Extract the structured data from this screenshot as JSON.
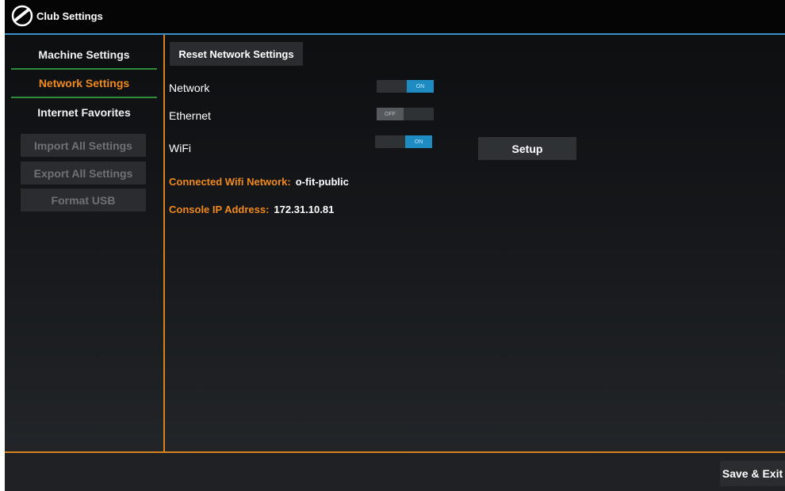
{
  "window": {
    "title": "Club Settings",
    "logo_icon": "brand-logo-icon"
  },
  "sidebar": {
    "items": [
      {
        "label": "Machine Settings"
      },
      {
        "label": "Network Settings",
        "active": true
      },
      {
        "label": "Internet Favorites"
      }
    ],
    "disabled_buttons": [
      {
        "label": "Import All Settings"
      },
      {
        "label": "Export All Settings"
      },
      {
        "label": "Format USB"
      }
    ]
  },
  "main": {
    "reset_label": "Reset Network Settings",
    "settings": [
      {
        "label": "Network",
        "state": "ON"
      },
      {
        "label": "Ethernet",
        "state": "OFF"
      },
      {
        "label": "WiFi",
        "state": "ON"
      }
    ],
    "setup_label": "Setup",
    "connected": {
      "label": "Connected Wifi Network:",
      "value": "o-fit-public"
    },
    "ip": {
      "label": "Console IP Address:",
      "value": "172.31.10.81"
    }
  },
  "footer": {
    "save_label": "Save & Exit"
  },
  "colors": {
    "accent_orange": "#f08a1c",
    "toggle_on_blue": "#1e8bc3",
    "separator_green": "#2e8b3a",
    "header_line_blue": "#3b8fc7"
  }
}
